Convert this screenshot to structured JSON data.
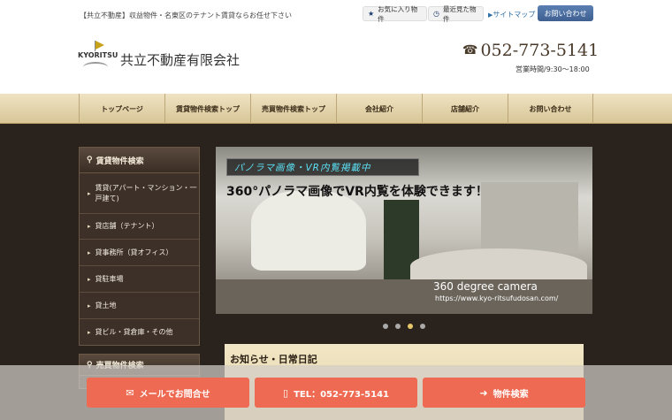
{
  "header": {
    "tagline": "【共立不動産】収益物件・名東区のテナント賃貸ならお任せ下さい",
    "favorites_label": "お気に入り物件",
    "recent_label": "最近見た物件",
    "sitemap_label": "サイトマップ",
    "contact_label": "お問い合わせ",
    "logo_text": "KYORITSU",
    "company_name": "共立不動産有限会社",
    "phone": "052-773-5141",
    "hours": "営業時間/9:30〜18:00"
  },
  "nav": {
    "items": [
      {
        "label": "トップページ"
      },
      {
        "label": "賃貸物件検索トップ"
      },
      {
        "label": "売買物件検索トップ"
      },
      {
        "label": "会社紹介"
      },
      {
        "label": "店舗紹介"
      },
      {
        "label": "お問い合わせ"
      }
    ]
  },
  "sidebar": {
    "title": "賃貸物件検索",
    "items": [
      {
        "label": "賃貸(アパート・マンション・一戸建て)"
      },
      {
        "label": "貸店舗（テナント）"
      },
      {
        "label": "貸事務所（貸オフィス）"
      },
      {
        "label": "貸駐車場"
      },
      {
        "label": "貸土地"
      },
      {
        "label": "貸ビル・貸倉庫・その他"
      }
    ],
    "second_title": "売買物件検索"
  },
  "banner": {
    "tag": "パノラマ画像・VR内覧掲載中",
    "headline": "360°パノラマ画像でVR内覧を体験できます！",
    "camera_text": "360 degree camera",
    "url_text": "https://www.kyo-ritsufudosan.com/",
    "slide_count": 4,
    "active_slide": 3
  },
  "news": {
    "title": "お知らせ・日常日記"
  },
  "cta": {
    "mail_label": "メールでお問合せ",
    "tel_label": "TEL：052-773-5141",
    "search_label": "物件検索"
  },
  "colors": {
    "cta": "#ef6a52",
    "nav_gold": "#d8c698",
    "sidebar_bg": "#3d3028",
    "banner_tag_text": "#5ce0f5"
  }
}
